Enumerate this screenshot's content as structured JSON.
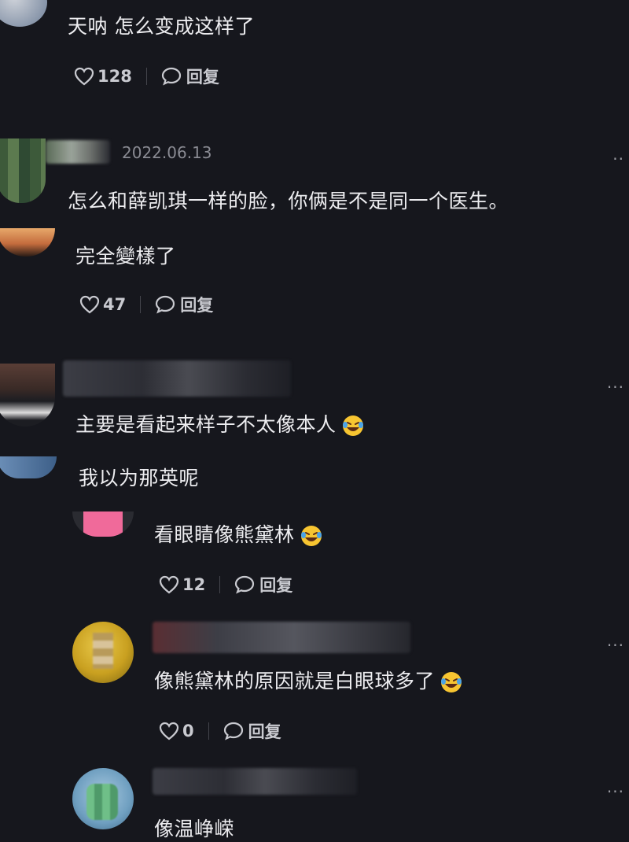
{
  "comments": [
    {
      "text": "天呐 怎么变成这样了",
      "likes": "128",
      "reply_label": "回复"
    },
    {
      "date": "2022.06.13",
      "text": "怎么和薛凯琪一样的脸，你俩是不是同一个医生。"
    },
    {
      "text": "完全變樣了",
      "likes": "47",
      "reply_label": "回复"
    },
    {
      "text": "主要是看起来样子不太像本人"
    },
    {
      "text": "我以为那英呢"
    },
    {
      "text": "看眼睛像熊黛林",
      "likes": "12",
      "reply_label": "回复"
    },
    {
      "text": "像熊黛林的原因就是白眼球多了",
      "likes": "0",
      "reply_label": "回复"
    },
    {
      "text": "像温峥嵘"
    }
  ],
  "more_label": "···",
  "icons": {
    "like": "heart-outline-icon",
    "reply": "speech-bubble-icon",
    "laugh": "laughing-crying-emoji"
  },
  "colors": {
    "background": "#16171d",
    "text": "#ededf0",
    "muted": "#8a8b93"
  }
}
